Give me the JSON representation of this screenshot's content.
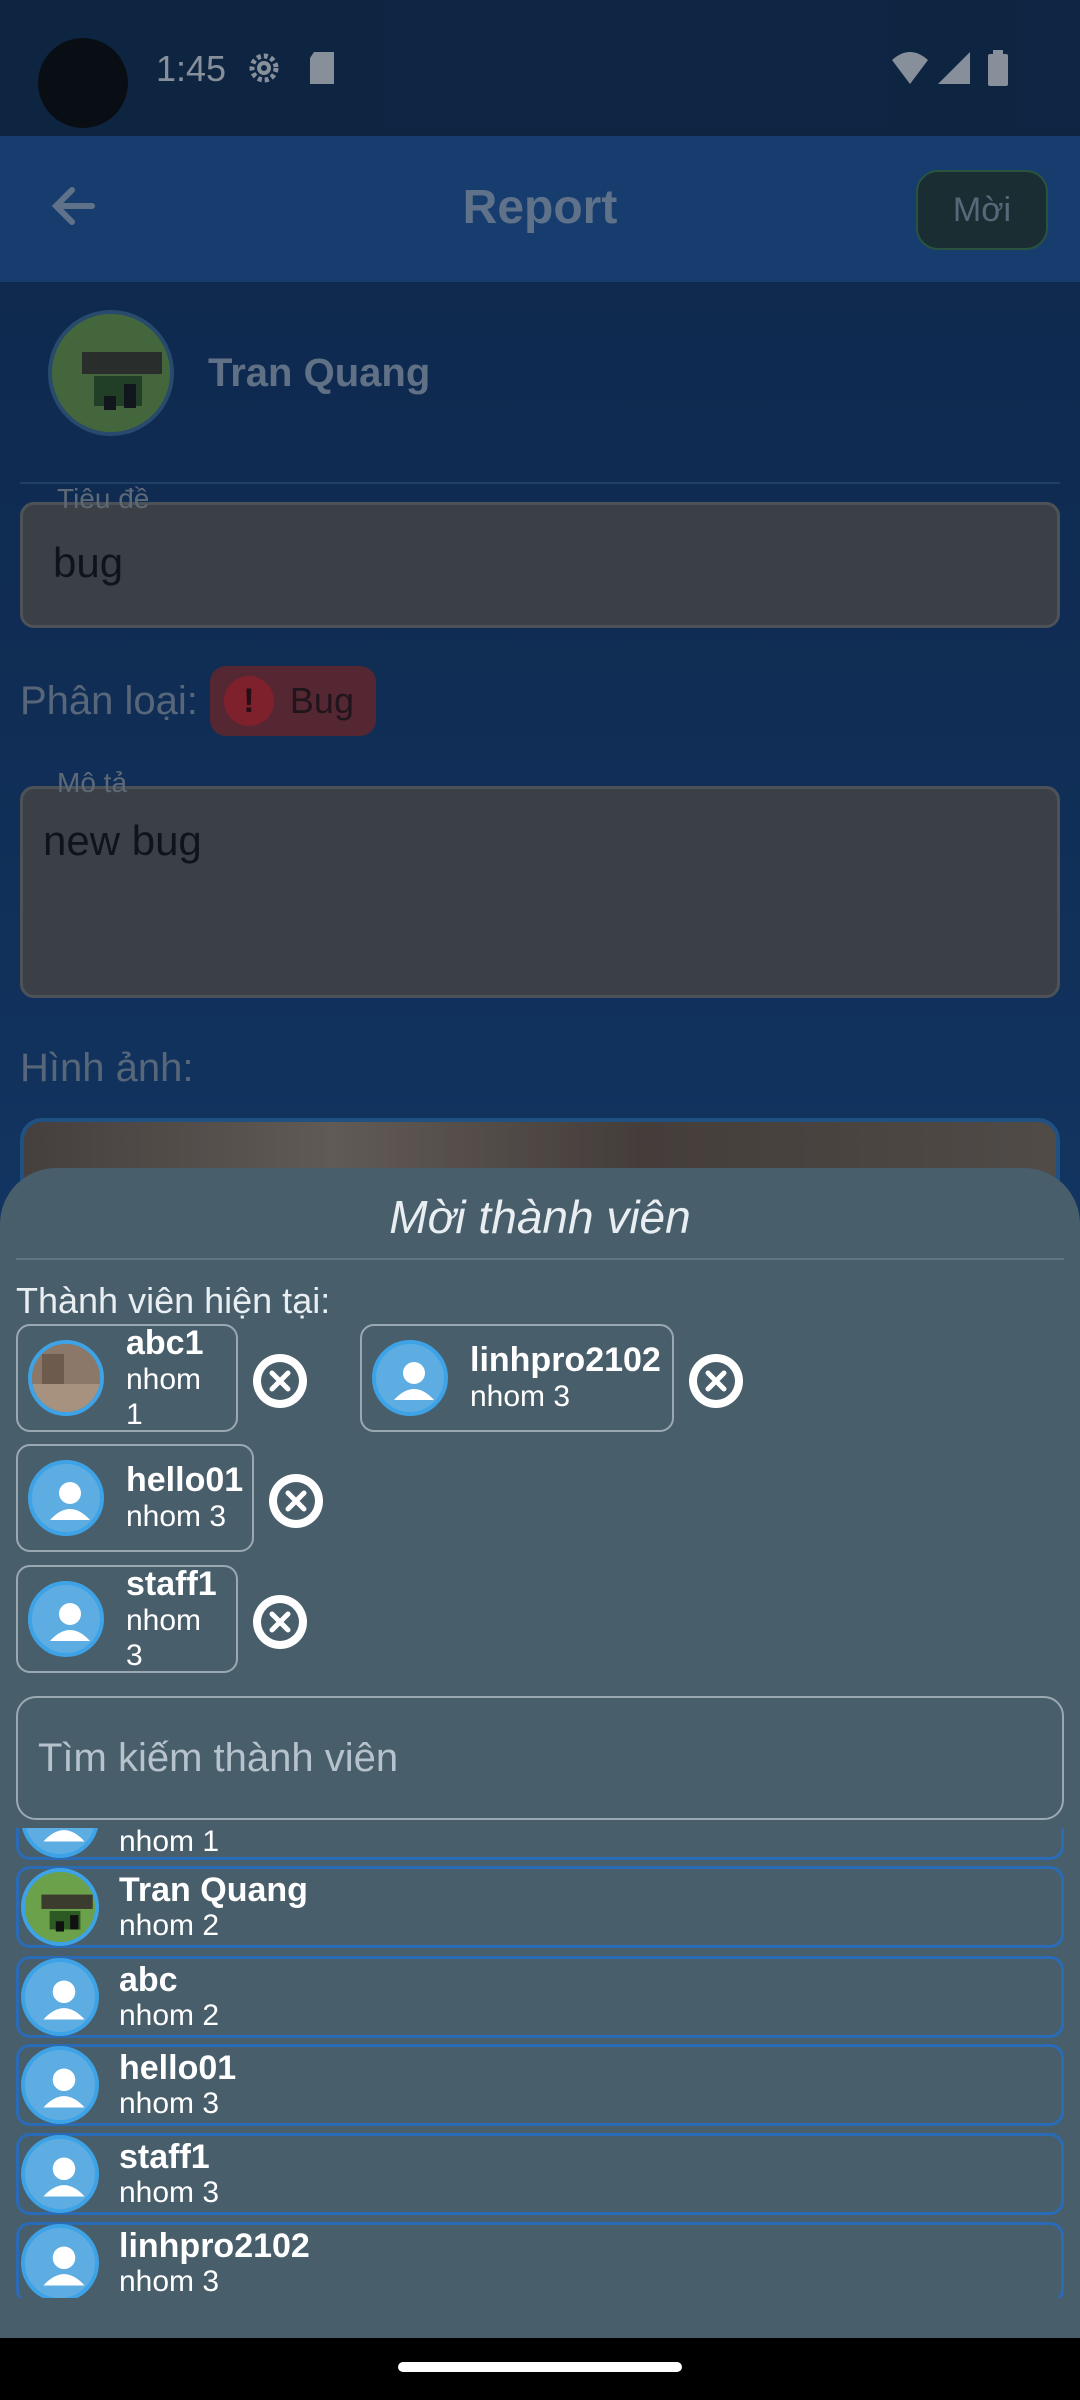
{
  "status_bar": {
    "time": "1:45"
  },
  "topbar": {
    "title": "Report",
    "invite_label": "Mời"
  },
  "reporter": {
    "name": "Tran Quang"
  },
  "form": {
    "title_label": "Tiêu đề",
    "title_value": "bug",
    "category_label": "Phân loại:",
    "category_value": "Bug",
    "category_icon": "!",
    "description_label": "Mô tả",
    "description_value": "new bug",
    "images_label": "Hình ảnh:"
  },
  "sheet": {
    "title": "Mời thành viên",
    "current_label": "Thành viên hiện tại:",
    "current_members": [
      {
        "name": "abc1",
        "group": "nhom 1"
      },
      {
        "name": "linhpro2102",
        "group": "nhom 3"
      },
      {
        "name": "hello01",
        "group": "nhom 3"
      },
      {
        "name": "staff1",
        "group": "nhom 3"
      }
    ],
    "search_placeholder": "Tìm kiếm thành viên",
    "results": [
      {
        "name": "",
        "group": "nhom 1"
      },
      {
        "name": "Tran Quang",
        "group": "nhom 2"
      },
      {
        "name": "abc",
        "group": "nhom 2"
      },
      {
        "name": "hello01",
        "group": "nhom 3"
      },
      {
        "name": "staff1",
        "group": "nhom 3"
      },
      {
        "name": "linhpro2102",
        "group": "nhom 3"
      }
    ]
  },
  "colors": {
    "accent": "#2a6bb8",
    "sheet_bg": "#485e6b",
    "avatar_blue": "#5dade2"
  }
}
